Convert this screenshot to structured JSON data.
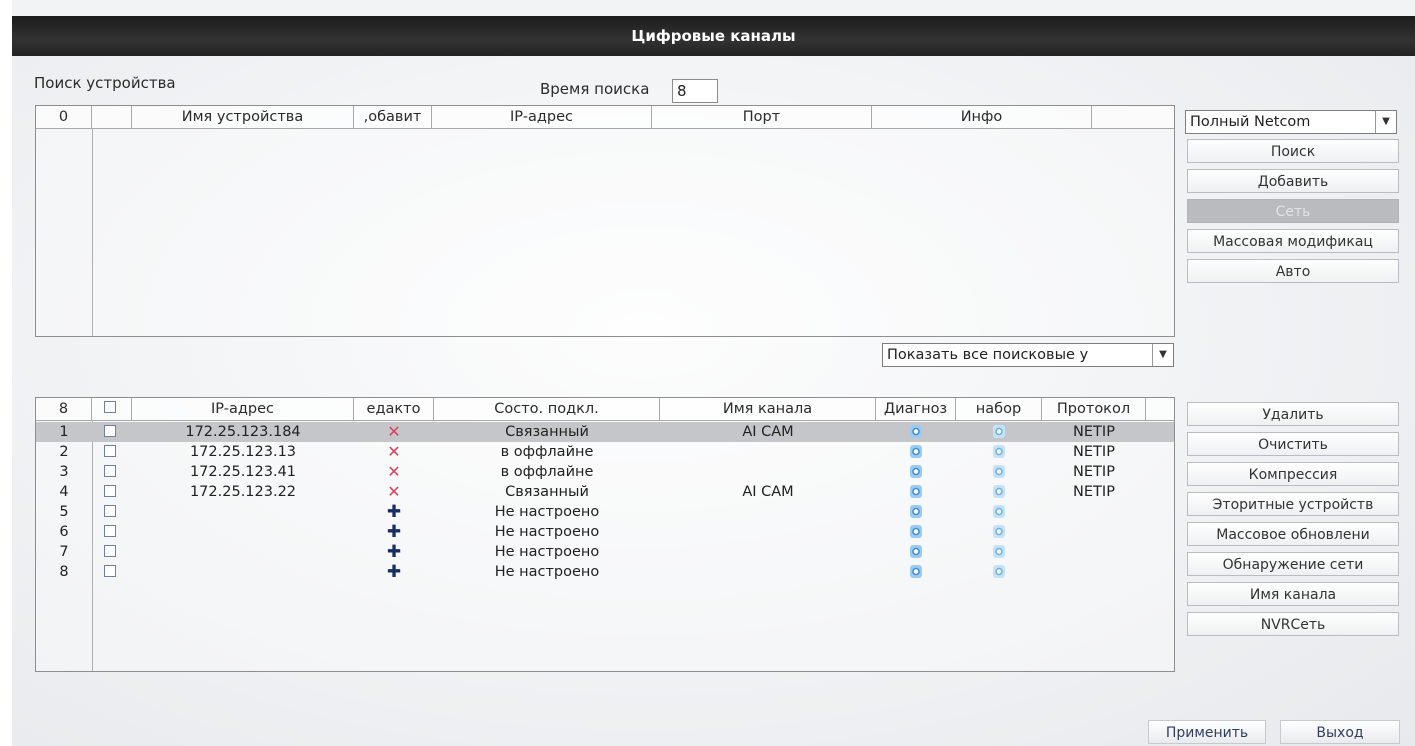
{
  "window": {
    "title": "Цифровые каналы"
  },
  "search": {
    "label": "Поиск устройства",
    "time_label": "Время поиска",
    "time_value": "8",
    "columns": [
      "0",
      "",
      "Имя устройства",
      ",обавит",
      "IP-адрес",
      "Порт",
      "Инфо"
    ],
    "filter_dropdown": "Показать все поисковые у"
  },
  "right_panel_top": {
    "protocol_dropdown": "Полный Netcom",
    "buttons": [
      "Поиск",
      "Добавить",
      "Сеть",
      "Массовая модификац",
      "Авто"
    ]
  },
  "channels": {
    "columns": [
      "8",
      "",
      "IP-адрес",
      "едакто",
      "Состо. подкл.",
      "Имя канала",
      "Диагноз",
      "набор",
      "Протокол"
    ],
    "rows": [
      {
        "num": "1",
        "ip": "172.25.123.184",
        "edit": "remove",
        "status": "Связанный",
        "name": "AI CAM",
        "protocol": "NETIP",
        "selected": true
      },
      {
        "num": "2",
        "ip": "172.25.123.13",
        "edit": "remove",
        "status": "в оффлайне",
        "name": "",
        "protocol": "NETIP",
        "selected": false
      },
      {
        "num": "3",
        "ip": "172.25.123.41",
        "edit": "remove",
        "status": "в оффлайне",
        "name": "",
        "protocol": "NETIP",
        "selected": false
      },
      {
        "num": "4",
        "ip": "172.25.123.22",
        "edit": "remove",
        "status": "Связанный",
        "name": "AI CAM",
        "protocol": "NETIP",
        "selected": false
      },
      {
        "num": "5",
        "ip": "",
        "edit": "add",
        "status": "Не настроено",
        "name": "",
        "protocol": "",
        "selected": false
      },
      {
        "num": "6",
        "ip": "",
        "edit": "add",
        "status": "Не настроено",
        "name": "",
        "protocol": "",
        "selected": false
      },
      {
        "num": "7",
        "ip": "",
        "edit": "add",
        "status": "Не настроено",
        "name": "",
        "protocol": "",
        "selected": false
      },
      {
        "num": "8",
        "ip": "",
        "edit": "add",
        "status": "Не настроено",
        "name": "",
        "protocol": "",
        "selected": false
      }
    ]
  },
  "right_panel_bottom": {
    "buttons": [
      "Удалить",
      "Очистить",
      "Компрессия",
      "Эторитные устройств",
      "Массовое обновлени",
      "Обнаружение сети",
      "Имя канала",
      "NVRСеть"
    ]
  },
  "footer": {
    "apply": "Применить",
    "exit": "Выход"
  },
  "icons": {
    "remove": "x-icon",
    "add": "plus-icon",
    "diagnose": "diagnose-icon",
    "settings": "settings-icon"
  },
  "colors": {
    "titlebar": "#222222",
    "remove_icon": "#d6435b",
    "add_icon": "#1a2e66",
    "selected_row": "#c5c6c9"
  }
}
